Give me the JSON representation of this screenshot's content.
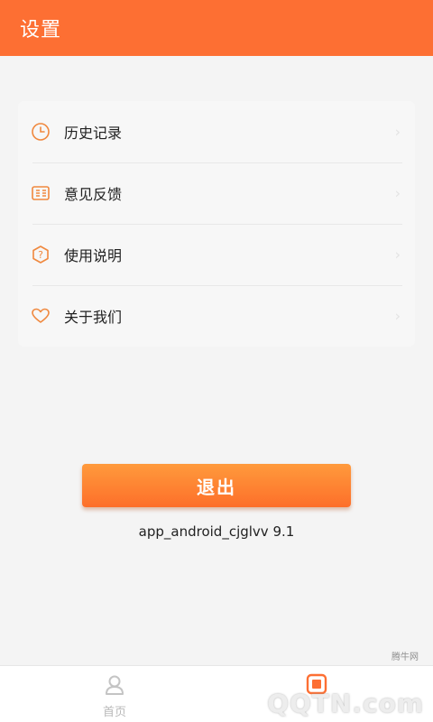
{
  "header": {
    "title": "设置"
  },
  "menu": {
    "items": [
      {
        "label": "历史记录",
        "icon": "clock-icon"
      },
      {
        "label": "意见反馈",
        "icon": "feedback-icon"
      },
      {
        "label": "使用说明",
        "icon": "help-icon"
      },
      {
        "label": "关于我们",
        "icon": "heart-icon"
      }
    ],
    "chevron": "›"
  },
  "logout": {
    "label": "退出"
  },
  "version": "app_android_cjglvv 9.1",
  "tabbar": {
    "home_label": "首页",
    "settings_label": ""
  },
  "watermark": {
    "brand": "QQTN.com",
    "small": "腾牛网"
  },
  "colors": {
    "accent": "#fd6f33",
    "button_top": "#ff9a3c",
    "button_bottom": "#fd6f2a"
  }
}
